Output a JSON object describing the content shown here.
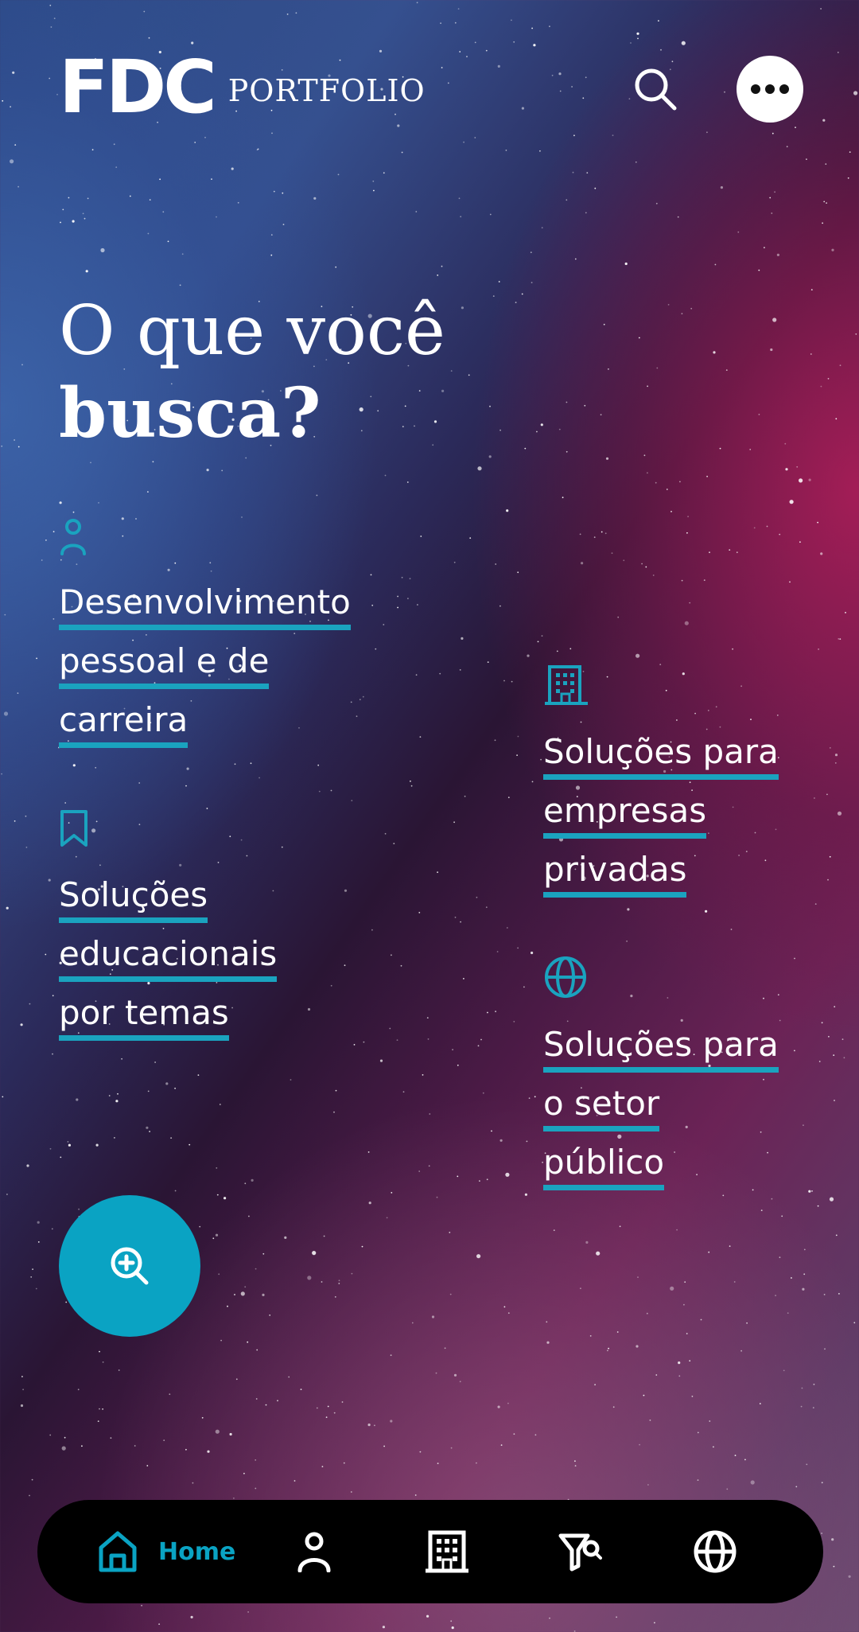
{
  "header": {
    "logo_mark": "FDC",
    "logo_sub": "PORTFOLIO",
    "search_icon": "search-icon",
    "more_icon": "more-horizontal-icon"
  },
  "headline": {
    "line1": "O que você",
    "line2": "busca?"
  },
  "categories": [
    {
      "icon": "person-icon",
      "lines": [
        "Desenvolvimento",
        "pessoal e de",
        "carreira"
      ]
    },
    {
      "icon": "bookmark-icon",
      "lines": [
        "Soluções",
        "educacionais",
        "por temas"
      ]
    },
    {
      "icon": "building-icon",
      "lines": [
        "Soluções para",
        "empresas",
        "privadas"
      ]
    },
    {
      "icon": "globe-icon",
      "lines": [
        "Soluções para",
        "o setor",
        "público"
      ]
    }
  ],
  "fab": {
    "icon": "zoom-in-icon"
  },
  "bottom_nav": {
    "items": [
      {
        "icon": "home-icon",
        "label": "Home",
        "active": true
      },
      {
        "icon": "person-icon",
        "label": ""
      },
      {
        "icon": "building-icon",
        "label": ""
      },
      {
        "icon": "filter-icon",
        "label": ""
      },
      {
        "icon": "globe-icon",
        "label": ""
      }
    ]
  },
  "colors": {
    "accent": "#0aa3c3",
    "underline": "#1aa3bf",
    "nav_background": "#000000",
    "text": "#ffffff"
  }
}
